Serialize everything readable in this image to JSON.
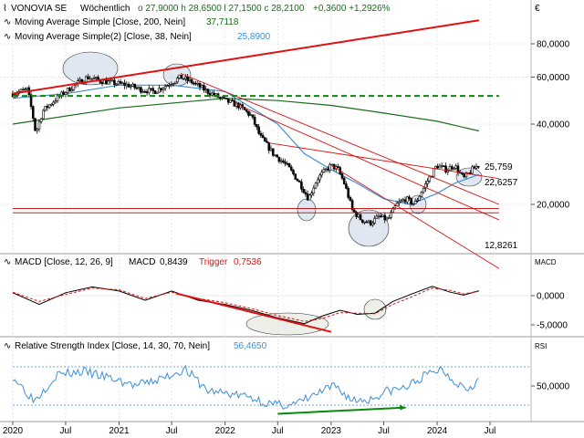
{
  "header": {
    "symbol": "VONOVIA SE",
    "interval": "Wöchentlich",
    "ohlc_text": "o 27,9000  h 28,6500  l 27,1500  c 28,2100",
    "change_text": "+0,3600  +1,2926%",
    "currency": "€"
  },
  "colors": {
    "candle": "#000000",
    "ma200": "#1a6b1a",
    "ma38": "#3d8fd6",
    "trend_red": "#e01010",
    "support_line": "#c00000",
    "dash_green": "#0a8a0a",
    "macd_line": "#000000",
    "trigger_line": "#e01010",
    "rsi_line": "#3d8fd6",
    "grid": "#d8d8d8"
  },
  "chart_data": [
    {
      "type": "candlestick",
      "panel": "price",
      "title": "VONOVIA SE  Wöchentlich",
      "legend": [
        {
          "text": "Moving Average Simple [Close, 200, Nein]",
          "value": "37,7118",
          "color": "#1a6b1a"
        },
        {
          "text": "Moving Average Simple(2) [Close, 38, Nein]",
          "value": "25,8900",
          "color": "#3d8fd6"
        }
      ],
      "y_scale": "log",
      "ylim": [
        13,
        100
      ],
      "y_ticks": [
        "80,0000",
        "60,0000",
        "40,0000",
        "20,0000"
      ],
      "y_tick_values": [
        80,
        60,
        40,
        20
      ],
      "x_ticks": [
        "2020",
        "Jul",
        "2021",
        "Jul",
        "2022",
        "Jul",
        "2023",
        "Jul",
        "2024",
        "Jul"
      ],
      "x_tick_dates": [
        "2020-01-01",
        "2020-07-01",
        "2021-01-01",
        "2021-07-01",
        "2022-01-01",
        "2022-07-01",
        "2023-01-01",
        "2023-07-01",
        "2024-01-01",
        "2024-07-01"
      ],
      "price_path": [
        [
          "2020-01-01",
          52
        ],
        [
          "2020-02-20",
          54
        ],
        [
          "2020-03-20",
          37
        ],
        [
          "2020-04-15",
          45
        ],
        [
          "2020-06-01",
          50
        ],
        [
          "2020-08-01",
          56
        ],
        [
          "2020-09-15",
          60
        ],
        [
          "2020-11-01",
          58
        ],
        [
          "2020-12-15",
          57
        ],
        [
          "2021-02-01",
          56
        ],
        [
          "2021-03-15",
          54
        ],
        [
          "2021-05-01",
          53
        ],
        [
          "2021-06-15",
          56
        ],
        [
          "2021-08-01",
          60
        ],
        [
          "2021-09-15",
          57
        ],
        [
          "2021-11-01",
          53
        ],
        [
          "2021-12-31",
          49
        ],
        [
          "2022-02-15",
          47
        ],
        [
          "2022-03-31",
          43
        ],
        [
          "2022-05-01",
          36
        ],
        [
          "2022-06-15",
          31
        ],
        [
          "2022-08-01",
          28
        ],
        [
          "2022-09-15",
          24
        ],
        [
          "2022-10-15",
          21
        ],
        [
          "2022-11-15",
          25
        ],
        [
          "2022-12-31",
          28
        ],
        [
          "2023-01-25",
          27
        ],
        [
          "2023-02-15",
          24
        ],
        [
          "2023-03-15",
          19
        ],
        [
          "2023-04-15",
          17.5
        ],
        [
          "2023-05-15",
          17
        ],
        [
          "2023-06-15",
          18
        ],
        [
          "2023-07-15",
          17.5
        ],
        [
          "2023-08-15",
          20
        ],
        [
          "2023-09-15",
          21
        ],
        [
          "2023-10-15",
          20
        ],
        [
          "2023-11-15",
          23
        ],
        [
          "2023-12-31",
          28
        ],
        [
          "2024-02-01",
          27
        ],
        [
          "2024-03-01",
          28
        ],
        [
          "2024-04-01",
          25
        ],
        [
          "2024-05-01",
          27
        ],
        [
          "2024-05-24",
          28.21
        ]
      ],
      "ma200_path": [
        [
          "2020-01-01",
          40
        ],
        [
          "2021-01-01",
          46
        ],
        [
          "2022-01-01",
          50
        ],
        [
          "2022-07-01",
          49
        ],
        [
          "2023-01-01",
          47
        ],
        [
          "2023-07-01",
          44
        ],
        [
          "2024-01-01",
          41
        ],
        [
          "2024-05-24",
          37.71
        ]
      ],
      "ma38_path": [
        [
          "2020-01-01",
          50
        ],
        [
          "2020-07-01",
          52
        ],
        [
          "2021-01-01",
          56
        ],
        [
          "2021-07-01",
          56
        ],
        [
          "2022-01-01",
          53
        ],
        [
          "2022-07-01",
          40
        ],
        [
          "2022-10-01",
          31
        ],
        [
          "2023-01-01",
          27
        ],
        [
          "2023-04-01",
          24
        ],
        [
          "2023-07-01",
          21
        ],
        [
          "2023-10-01",
          20
        ],
        [
          "2024-01-01",
          22
        ],
        [
          "2024-03-01",
          24
        ],
        [
          "2024-05-24",
          25.89
        ]
      ],
      "trendlines": [
        {
          "name": "uptrend",
          "from": [
            "2020-01-01",
            52
          ],
          "to": [
            "2024-05-24",
            98
          ],
          "color": "#e01010"
        },
        {
          "name": "downtrend-1",
          "from": [
            "2021-08-01",
            62
          ],
          "to": [
            "2024-08-01",
            20
          ],
          "color": "#e01010"
        },
        {
          "name": "downtrend-2",
          "from": [
            "2022-02-01",
            48
          ],
          "to": [
            "2024-08-01",
            17.5
          ],
          "color": "#e01010"
        },
        {
          "name": "downtrend-3",
          "from": [
            "2022-06-01",
            34
          ],
          "to": [
            "2024-08-01",
            25
          ],
          "color": "#e01010"
        },
        {
          "name": "downtrend-4",
          "from": [
            "2023-01-01",
            28
          ],
          "to": [
            "2024-08-01",
            11.5
          ],
          "color": "#e01010"
        },
        {
          "name": "support-top",
          "from": [
            "2020-01-01",
            19.3
          ],
          "to": [
            "2024-08-01",
            19.3
          ],
          "color": "#c00000"
        },
        {
          "name": "support-bottom",
          "from": [
            "2020-01-01",
            18.6
          ],
          "to": [
            "2024-08-01",
            18.6
          ],
          "color": "#c00000"
        },
        {
          "name": "resistance-dashed",
          "from": [
            "2020-01-01",
            51
          ],
          "to": [
            "2024-08-01",
            51
          ],
          "color": "#0a8a0a"
        }
      ],
      "annotations": [
        "25,759",
        "22,6257",
        "12,8261"
      ],
      "annotation_values": [
        25.759,
        22.6257,
        12.8261
      ]
    },
    {
      "type": "line",
      "panel": "macd",
      "title": "MACD [Close, 12, 26, 9]",
      "legend": [
        {
          "text": "MACD",
          "value": "0,8439",
          "color": "#000000"
        },
        {
          "text": "Trigger",
          "value": "0,7536",
          "color": "#e01010"
        }
      ],
      "panel_label": "MACD",
      "ylim": [
        -6,
        4
      ],
      "y_ticks": [
        "0,0000",
        "-5,0000"
      ],
      "y_tick_values": [
        0,
        -5
      ],
      "macd_path": [
        [
          "2020-01-01",
          0.5
        ],
        [
          "2020-04-01",
          -1.5
        ],
        [
          "2020-07-01",
          0.5
        ],
        [
          "2020-10-01",
          1.5
        ],
        [
          "2021-01-01",
          0.8
        ],
        [
          "2021-04-01",
          -0.8
        ],
        [
          "2021-07-01",
          0.8
        ],
        [
          "2021-10-01",
          -0.8
        ],
        [
          "2022-01-01",
          -1.5
        ],
        [
          "2022-04-01",
          -2.5
        ],
        [
          "2022-07-01",
          -3.8
        ],
        [
          "2022-10-01",
          -4.8
        ],
        [
          "2022-12-01",
          -3.5
        ],
        [
          "2023-02-01",
          -2.5
        ],
        [
          "2023-04-01",
          -3.2
        ],
        [
          "2023-06-01",
          -3.0
        ],
        [
          "2023-08-01",
          -1.0
        ],
        [
          "2023-10-01",
          0.2
        ],
        [
          "2023-12-15",
          1.6
        ],
        [
          "2024-02-15",
          0.6
        ],
        [
          "2024-04-01",
          0.1
        ],
        [
          "2024-05-24",
          0.84
        ]
      ],
      "trigger_path": [
        [
          "2020-01-01",
          0.6
        ],
        [
          "2020-04-01",
          -1.0
        ],
        [
          "2020-07-01",
          0.2
        ],
        [
          "2020-10-01",
          1.3
        ],
        [
          "2021-01-01",
          1.0
        ],
        [
          "2021-04-01",
          -0.5
        ],
        [
          "2021-07-01",
          0.6
        ],
        [
          "2021-10-01",
          -0.5
        ],
        [
          "2022-01-01",
          -1.2
        ],
        [
          "2022-04-01",
          -2.2
        ],
        [
          "2022-07-01",
          -3.4
        ],
        [
          "2022-10-01",
          -4.4
        ],
        [
          "2022-12-01",
          -3.9
        ],
        [
          "2023-02-01",
          -2.9
        ],
        [
          "2023-04-01",
          -3.0
        ],
        [
          "2023-06-01",
          -3.1
        ],
        [
          "2023-08-01",
          -1.5
        ],
        [
          "2023-10-01",
          -0.3
        ],
        [
          "2023-12-15",
          1.3
        ],
        [
          "2024-02-15",
          0.9
        ],
        [
          "2024-04-01",
          0.3
        ],
        [
          "2024-05-24",
          0.75
        ]
      ],
      "trendlines": [
        {
          "name": "macd-downtrend",
          "from": [
            "2021-07-15",
            0.4
          ],
          "to": [
            "2023-01-01",
            -6.2
          ],
          "color": "#e01010"
        }
      ]
    },
    {
      "type": "line",
      "panel": "rsi",
      "title": "Relative Strength Index [Close, 14, 30, 70, Nein]",
      "legend": [
        {
          "text": "Relative Strength Index",
          "value": "56,4650",
          "color": "#3d8fd6"
        }
      ],
      "panel_label": "RSI",
      "ylim": [
        20,
        85
      ],
      "y_ticks": [
        "50,0000"
      ],
      "y_tick_values": [
        50
      ],
      "bands": [
        30,
        70
      ],
      "rsi_path": [
        [
          "2020-01-01",
          60
        ],
        [
          "2020-03-15",
          35
        ],
        [
          "2020-06-01",
          62
        ],
        [
          "2020-09-01",
          65
        ],
        [
          "2020-12-01",
          58
        ],
        [
          "2021-03-01",
          50
        ],
        [
          "2021-06-01",
          58
        ],
        [
          "2021-08-15",
          68
        ],
        [
          "2021-11-01",
          45
        ],
        [
          "2022-01-15",
          42
        ],
        [
          "2022-04-01",
          38
        ],
        [
          "2022-06-15",
          30
        ],
        [
          "2022-09-01",
          31
        ],
        [
          "2022-11-15",
          42
        ],
        [
          "2023-01-15",
          50
        ],
        [
          "2023-03-15",
          35
        ],
        [
          "2023-05-15",
          36
        ],
        [
          "2023-07-15",
          45
        ],
        [
          "2023-09-15",
          48
        ],
        [
          "2023-11-15",
          60
        ],
        [
          "2024-01-15",
          68
        ],
        [
          "2024-03-01",
          55
        ],
        [
          "2024-04-15",
          48
        ],
        [
          "2024-05-24",
          56.47
        ]
      ],
      "trendlines": [
        {
          "name": "rsi-uptrend",
          "from": [
            "2022-07-01",
            21
          ],
          "to": [
            "2023-09-15",
            27.5
          ],
          "color": "#0a8a0a"
        }
      ]
    }
  ]
}
